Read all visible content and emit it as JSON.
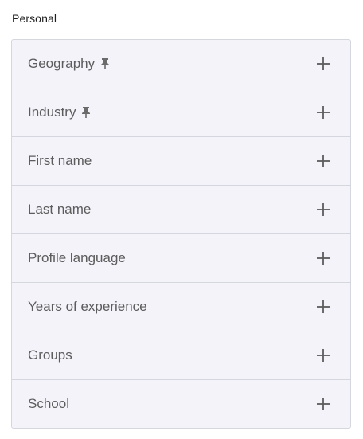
{
  "section": {
    "title": "Personal"
  },
  "filters": [
    {
      "label": "Geography",
      "pinned": true
    },
    {
      "label": "Industry",
      "pinned": true
    },
    {
      "label": "First name",
      "pinned": false
    },
    {
      "label": "Last name",
      "pinned": false
    },
    {
      "label": "Profile language",
      "pinned": false
    },
    {
      "label": "Years of experience",
      "pinned": false
    },
    {
      "label": "Groups",
      "pinned": false
    },
    {
      "label": "School",
      "pinned": false
    }
  ],
  "icons": {
    "add": "plus-icon",
    "pin": "pin-icon"
  },
  "colors": {
    "row_background": "#f3f3f9",
    "border": "#d5d7df",
    "label_text": "#5c5c5c",
    "icon": "#5c5c5c"
  }
}
